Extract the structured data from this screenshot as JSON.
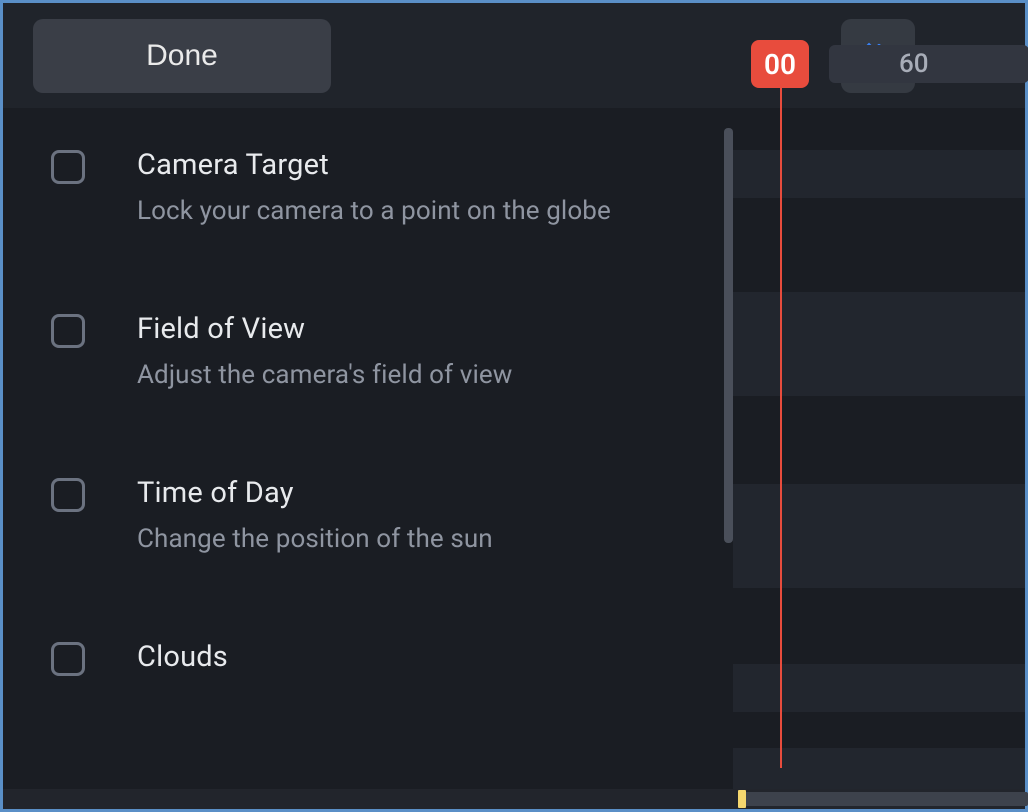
{
  "toolbar": {
    "done_label": "Done",
    "playhead_value": "00",
    "ruler_tick": "60"
  },
  "options": [
    {
      "title": "Camera Target",
      "desc": "Lock your camera to a point on the globe"
    },
    {
      "title": "Field of View",
      "desc": "Adjust the camera's field of view"
    },
    {
      "title": "Time of Day",
      "desc": "Change the position of the sun"
    },
    {
      "title": "Clouds",
      "desc": ""
    }
  ],
  "colors": {
    "accent_red": "#e84c3d",
    "accent_blue": "#3a82f7",
    "accent_yellow": "#f5d76e"
  }
}
